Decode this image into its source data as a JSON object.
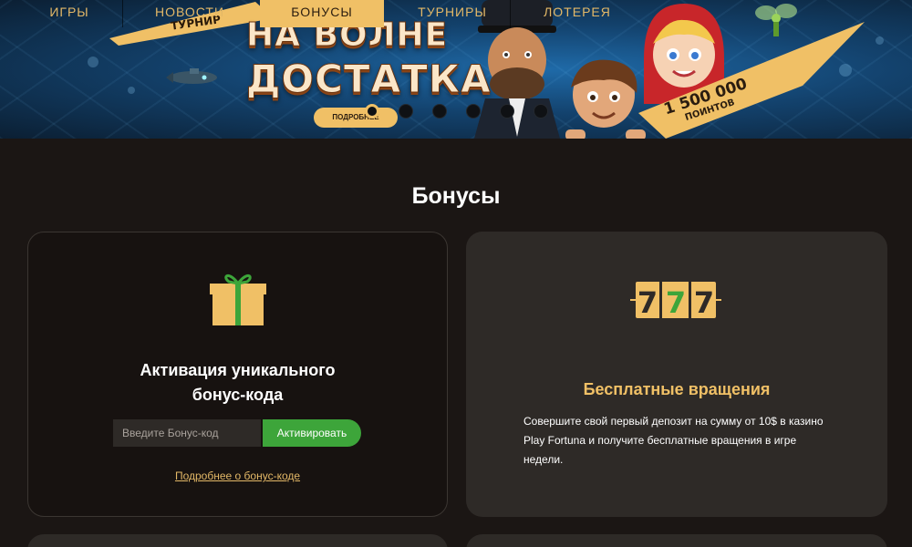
{
  "nav": {
    "items": [
      {
        "label": "ИГРЫ",
        "active": false
      },
      {
        "label": "НОВОСТИ",
        "active": false
      },
      {
        "label": "БОНУСЫ",
        "active": true
      },
      {
        "label": "ТУРНИРЫ",
        "active": false
      },
      {
        "label": "ЛОТЕРЕЯ",
        "active": false
      }
    ]
  },
  "banner": {
    "tag": "ТУРНИР",
    "headline_line1": "НА ВОЛНЕ",
    "headline_line2": "ДОСТАТКА",
    "more_button": "ПОДРОБНЕЕ",
    "points_value": "1 500 000",
    "points_unit": "ПОИНТОВ",
    "slides_count": 6,
    "active_slide": 1
  },
  "page": {
    "title": "Бонусы"
  },
  "bonus_code_card": {
    "icon": "gift-icon",
    "title_line1": "Активация уникального",
    "title_line2": "бонус-кода",
    "input_placeholder": "Введите Бонус-код",
    "activate_button": "Активировать",
    "more_link": "Подробнее о бонус-коде"
  },
  "free_spins_card": {
    "icon": "slot-777-icon",
    "title": "Бесплатные вращения",
    "description": "Совершите свой первый депозит на сумму от 10$ в казино Play Fortuna и получите бесплатные вращения в игре недели."
  },
  "colors": {
    "accent": "#f0c066",
    "background": "#1b1614",
    "card": "#2e2a27",
    "button_green": "#3da53a"
  }
}
